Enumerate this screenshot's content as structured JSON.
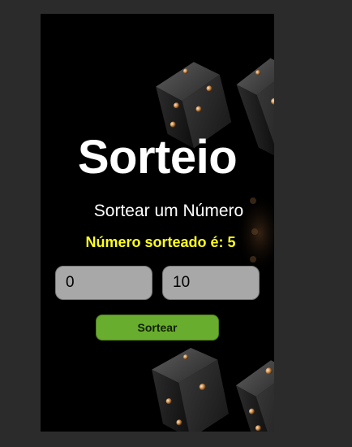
{
  "app": {
    "title": "Sorteio",
    "subtitle": "Sortear um Número",
    "result_text": "Número sorteado é: 5"
  },
  "inputs": {
    "min_value": "0",
    "max_value": "10"
  },
  "actions": {
    "draw_label": "Sortear"
  },
  "colors": {
    "background": "#000000",
    "result_text": "#ffff1e",
    "button": "#68ad2d",
    "input": "#a8a8a8",
    "outer": "#2b2b2b"
  },
  "icons": {
    "background_image": "dice-icon"
  }
}
